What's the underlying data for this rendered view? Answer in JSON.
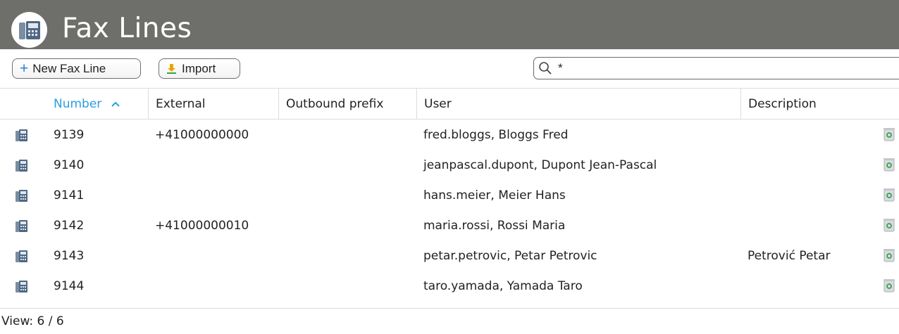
{
  "header": {
    "title": "Fax Lines",
    "icon": "fax-icon"
  },
  "toolbar": {
    "new_label": "New Fax Line",
    "import_label": "Import",
    "search_value": "*"
  },
  "table": {
    "columns": [
      "Number",
      "External",
      "Outbound prefix",
      "User",
      "Description"
    ],
    "sorted_column": "Number",
    "sort_direction": "ascending",
    "rows": [
      {
        "number": "9139",
        "external": "+41000000000",
        "prefix": "",
        "user": "fred.bloggs, Bloggs Fred",
        "description": ""
      },
      {
        "number": "9140",
        "external": "",
        "prefix": "",
        "user": "jeanpascal.dupont, Dupont Jean-Pascal",
        "description": ""
      },
      {
        "number": "9141",
        "external": "",
        "prefix": "",
        "user": "hans.meier, Meier Hans",
        "description": ""
      },
      {
        "number": "9142",
        "external": "+41000000010",
        "prefix": "",
        "user": "maria.rossi, Rossi Maria",
        "description": ""
      },
      {
        "number": "9143",
        "external": "",
        "prefix": "",
        "user": "petar.petrovic, Petar Petrovic",
        "description": "Petrović Petar"
      },
      {
        "number": "9144",
        "external": "",
        "prefix": "",
        "user": "taro.yamada, Yamada Taro",
        "description": ""
      }
    ]
  },
  "footer": {
    "view_text": "View: 6 / 6"
  },
  "colors": {
    "titlebar": "#6e6e6a",
    "accent": "#2a9fe0",
    "import_icon": "#e6a800"
  }
}
